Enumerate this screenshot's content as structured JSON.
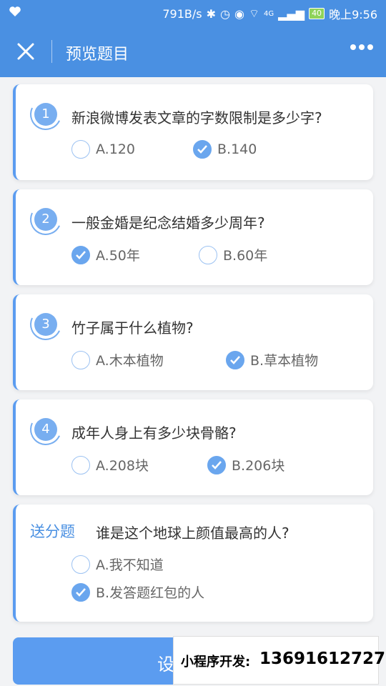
{
  "status_bar": {
    "speed": "791B/s",
    "battery": "40",
    "time": "晚上9:56",
    "network": "4G"
  },
  "navbar": {
    "title": "预览题目",
    "close_icon": "close-icon",
    "more_icon": "more-dots-icon"
  },
  "questions": [
    {
      "num": "1",
      "text": "新浪微博发表文章的字数限制是多少字?",
      "options": [
        {
          "label": "A.120",
          "checked": false
        },
        {
          "label": "B.140",
          "checked": true
        }
      ]
    },
    {
      "num": "2",
      "text": "一般金婚是纪念结婚多少周年?",
      "options": [
        {
          "label": "A.50年",
          "checked": true
        },
        {
          "label": "B.60年",
          "checked": false
        }
      ]
    },
    {
      "num": "3",
      "text": "竹子属于什么植物?",
      "options": [
        {
          "label": "A.木本植物",
          "checked": false
        },
        {
          "label": "B.草本植物",
          "checked": true
        }
      ]
    },
    {
      "num": "4",
      "text": "成年人身上有多少块骨骼?",
      "options": [
        {
          "label": "A.208块",
          "checked": false
        },
        {
          "label": "B.206块",
          "checked": true
        }
      ]
    }
  ],
  "bonus": {
    "label": "送分题",
    "text": "谁是这个地球上颜值最高的人?",
    "options": [
      {
        "label": "A.我不知道",
        "checked": false
      },
      {
        "label": "B.发答题红包的人",
        "checked": true
      }
    ]
  },
  "bottom_button": {
    "label": "设"
  },
  "promo": {
    "label": "小程序开发:",
    "phone": "13691612727"
  },
  "colors": {
    "accent": "#4a90e2",
    "check": "#6aa6ee"
  }
}
